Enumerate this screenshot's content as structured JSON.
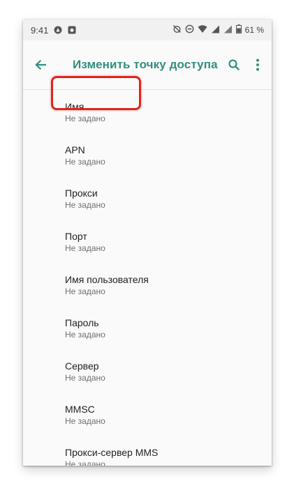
{
  "status_bar": {
    "time": "9:41",
    "battery": "61 %"
  },
  "app_bar": {
    "title": "Изменить точку доступа"
  },
  "preferences": [
    {
      "title": "Имя",
      "summary": "Не задано"
    },
    {
      "title": "APN",
      "summary": "Не задано"
    },
    {
      "title": "Прокси",
      "summary": "Не задано"
    },
    {
      "title": "Порт",
      "summary": "Не задано"
    },
    {
      "title": "Имя пользователя",
      "summary": "Не задано"
    },
    {
      "title": "Пароль",
      "summary": "Не задано"
    },
    {
      "title": "Сервер",
      "summary": "Не задано"
    },
    {
      "title": "MMSC",
      "summary": "Не задано"
    },
    {
      "title": "Прокси-сервер MMS",
      "summary": "Не задано"
    }
  ],
  "colors": {
    "accent": "#2f8f7e",
    "highlight": "#e0241c"
  }
}
